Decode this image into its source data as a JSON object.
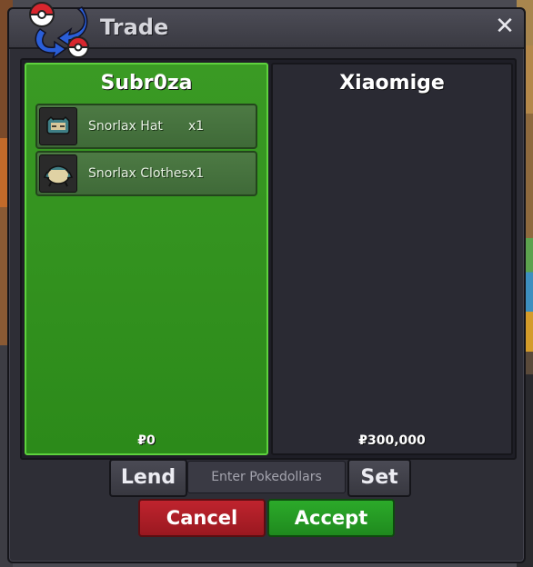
{
  "window": {
    "title": "Trade",
    "close_label": "✕"
  },
  "left_panel": {
    "player": "Subr0za",
    "money": "₽0",
    "items": [
      {
        "name": "Snorlax Hat",
        "qty": "x1",
        "icon": "snorlax-hat-icon"
      },
      {
        "name": "Snorlax Clothes",
        "qty": "x1",
        "icon": "snorlax-clothes-icon"
      }
    ]
  },
  "right_panel": {
    "player": "Xiaomige",
    "money": "₽300,000"
  },
  "controls": {
    "lend_label": "Lend",
    "pokedollars_placeholder": "Enter Pokedollars",
    "set_label": "Set",
    "cancel_label": "Cancel",
    "accept_label": "Accept"
  },
  "colors": {
    "offer_panel_green": "#2c8a1a",
    "cancel_red": "#b0202a",
    "accept_green": "#2a9e28"
  }
}
